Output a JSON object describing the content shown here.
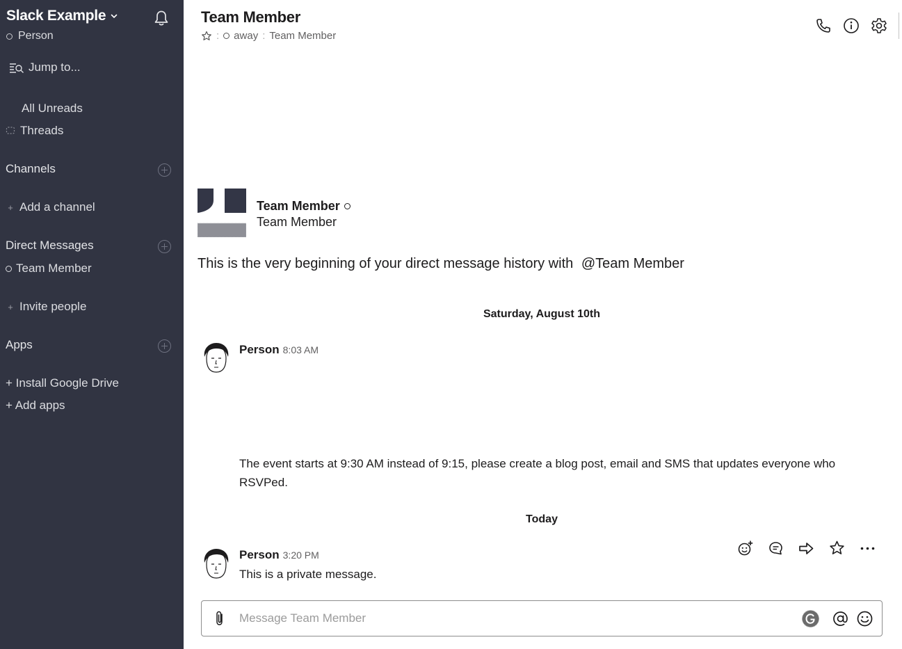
{
  "sidebar": {
    "workspace_name": "Slack Example",
    "user_name": "Person",
    "jump_label": "Jump to...",
    "all_unreads": "All Unreads",
    "threads": "Threads",
    "channels_header": "Channels",
    "add_channel": "Add a channel",
    "dm_header": "Direct Messages",
    "dm_team_member": "Team Member",
    "invite_people": "Invite people",
    "apps_header": "Apps",
    "install_google_drive": "+ Install Google Drive",
    "add_apps": "+ Add apps"
  },
  "header": {
    "title": "Team Member",
    "status": "away",
    "subtitle": "Team Member",
    "icons": [
      "phone-icon",
      "info-icon",
      "gear-icon"
    ]
  },
  "intro": {
    "name": "Team Member",
    "subtitle": "Team Member",
    "text": "This is the very beginning of your direct message history with",
    "mention": "@Team Member"
  },
  "messages": [
    {
      "day_label": "Saturday, August 10th",
      "author": "Person",
      "time": "8:03 AM",
      "body": "The event starts at 9:30 AM instead of 9:15, please create a blog post, email and SMS that updates everyone who RSVPed."
    },
    {
      "day_label": "Today",
      "author": "Person",
      "time": "3:20 PM",
      "body": "This is a private message."
    }
  ],
  "message_actions": [
    "add-reaction-icon",
    "start-thread-icon",
    "share-message-icon",
    "star-icon",
    "more-actions-icon"
  ],
  "composer": {
    "placeholder": "Message Team Member"
  },
  "colors": {
    "sidebar_bg": "#313442",
    "sidebar_text": "#dcdde1",
    "text": "#1d1c1d",
    "muted": "#616061"
  }
}
